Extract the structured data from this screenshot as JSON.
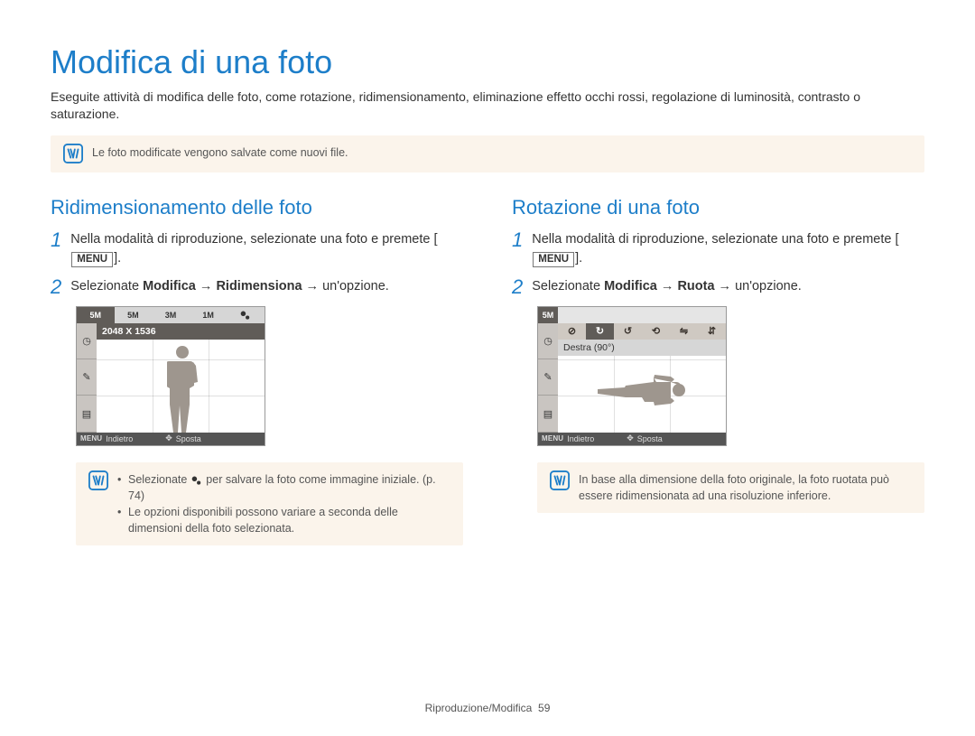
{
  "title": "Modifica di una foto",
  "intro": "Eseguite attività di modiﬁca delle foto, come rotazione, ridimensionamento, eliminazione effetto occhi rossi, regolazione di luminosità, contrasto o saturazione.",
  "top_note": "Le foto modiﬁcate vengono salvate come nuovi ﬁle.",
  "left": {
    "heading": "Ridimensionamento delle foto",
    "step1_pre": "Nella modalità di riproduzione, selezionate una foto e premete [",
    "step1_menu": "MENU",
    "step1_post": "].",
    "step2_pre": "Selezionate ",
    "step2_b1": "Modiﬁca",
    "step2_arrow1": " → ",
    "step2_b2": "Ridimensiona",
    "step2_arrow2": " → ",
    "step2_post": "un'opzione.",
    "cam": {
      "tabs": [
        "5M",
        "5M",
        "3M",
        "1M"
      ],
      "active_tab_index": 0,
      "banner": "2048 X 1536",
      "footer_back_label": "Indietro",
      "footer_back_btn": "MENU",
      "footer_move_label": "Sposta"
    },
    "note_bullet1_pre": "Selezionate ",
    "note_bullet1_post": " per salvare la foto come immagine iniziale. (p. 74)",
    "note_bullet2": "Le opzioni disponibili possono variare a seconda delle dimensioni della foto selezionata."
  },
  "right": {
    "heading": "Rotazione di una foto",
    "step1_pre": "Nella modalità di riproduzione, selezionate una foto e premete [",
    "step1_menu": "MENU",
    "step1_post": "].",
    "step2_pre": "Selezionate ",
    "step2_b1": "Modiﬁca",
    "step2_arrow1": " → ",
    "step2_b2": "Ruota",
    "step2_arrow2": " → ",
    "step2_post": "un'opzione.",
    "cam": {
      "tab": "5M",
      "banner": "Destra (90°)",
      "footer_back_label": "Indietro",
      "footer_back_btn": "MENU",
      "footer_move_label": "Sposta"
    },
    "note": "In base alla dimensione della foto originale, la foto ruotata può essere ridimensionata ad una risoluzione inferiore."
  },
  "footer": {
    "section": "Riproduzione/Modiﬁca",
    "page": "59"
  }
}
